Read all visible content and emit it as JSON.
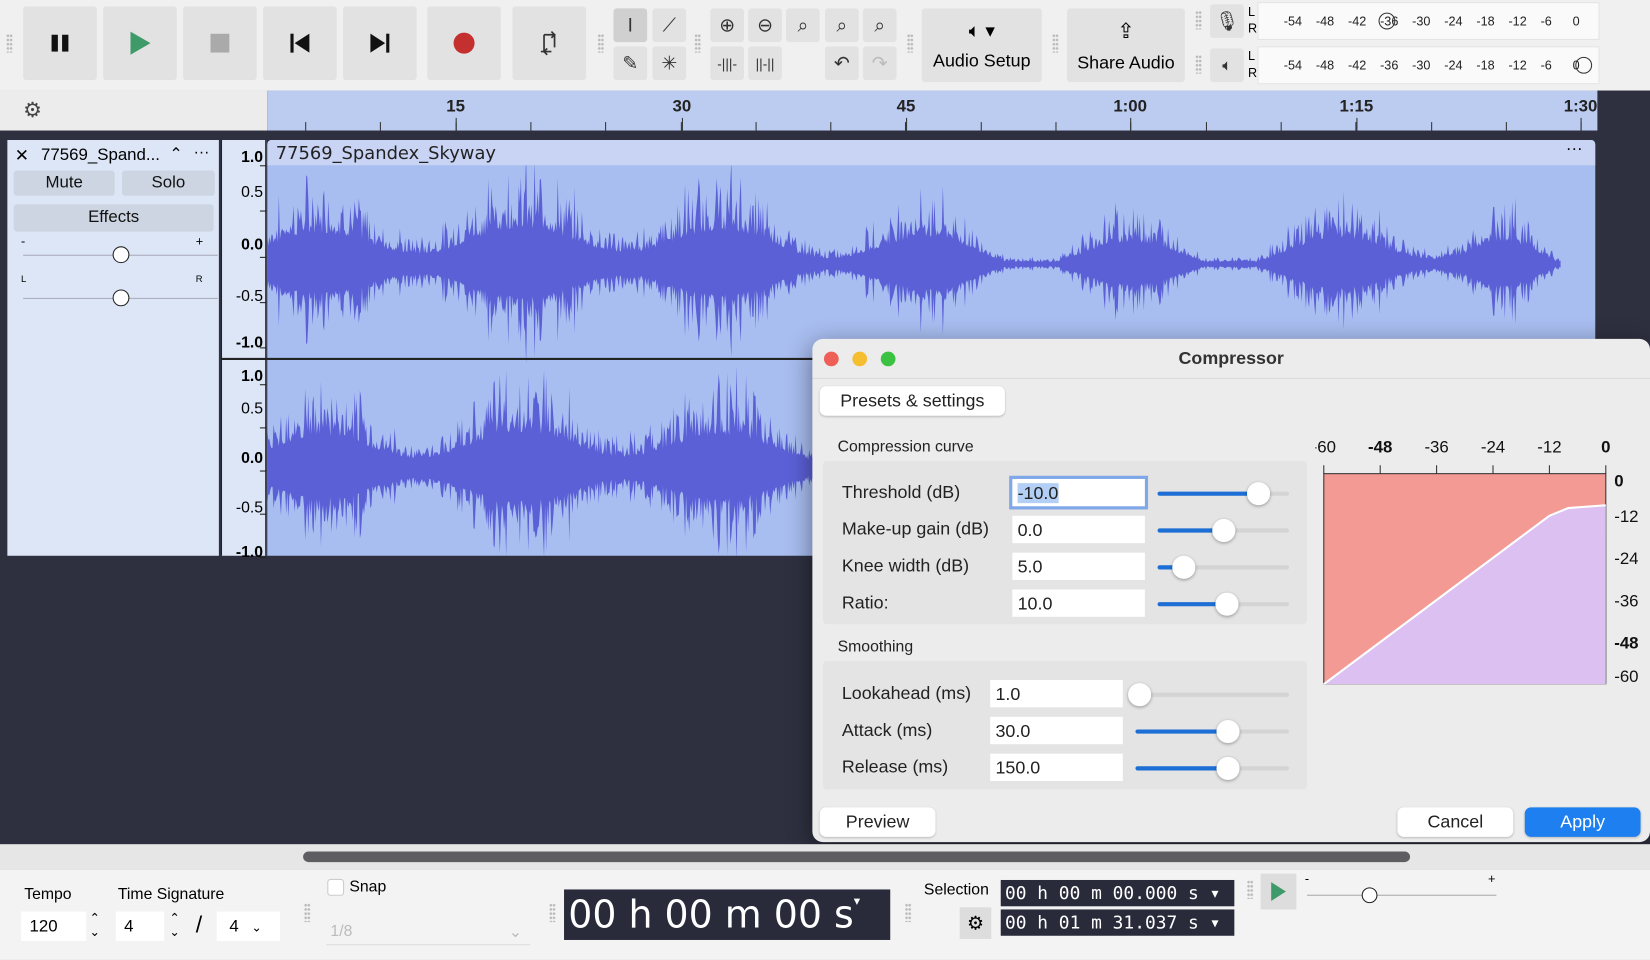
{
  "toolbar": {
    "transport": [
      "pause",
      "play",
      "stop",
      "skip-to-start",
      "skip-to-end",
      "record",
      "loop"
    ],
    "audio_setup": "Audio Setup",
    "share_audio": "Share Audio",
    "record_meter": {
      "channels": [
        "L",
        "R"
      ],
      "ticks": [
        "-54",
        "-48",
        "-42",
        "-36",
        "-30",
        "-24",
        "-18",
        "-12",
        "-6",
        "0"
      ]
    },
    "playback_meter": {
      "channels": [
        "L",
        "R"
      ],
      "ticks": [
        "-54",
        "-48",
        "-42",
        "-36",
        "-30",
        "-24",
        "-18",
        "-12",
        "-6",
        "0"
      ]
    }
  },
  "ruler": {
    "labels": [
      "15",
      "30",
      "45",
      "1:00",
      "1:15",
      "1:30"
    ]
  },
  "track": {
    "name": "77569_Spand...",
    "clip_name": "77569_Spandex_Skyway",
    "mute": "Mute",
    "solo": "Solo",
    "effects": "Effects",
    "gain_min": "-",
    "gain_max": "+",
    "pan_left": "L",
    "pan_right": "R",
    "scale": [
      "1.0",
      "0.5",
      "0.0",
      "-0.5",
      "-1.0"
    ],
    "gain_level": 0.5,
    "pan_level": 0.5,
    "wave_color": "#5b60d6"
  },
  "dialog": {
    "title": "Compressor",
    "presets": "Presets & settings",
    "curve_section": "Compression curve",
    "curve_params": [
      {
        "label": "Threshold (dB)",
        "value": "-10.0",
        "level": 0.77
      },
      {
        "label": "Make-up gain (dB)",
        "value": "0.0",
        "level": 0.5
      },
      {
        "label": "Knee width (dB)",
        "value": "5.0",
        "level": 0.2
      },
      {
        "label": "Ratio:",
        "value": "10.0",
        "level": 0.53
      }
    ],
    "smoothing_section": "Smoothing",
    "smoothing_params": [
      {
        "label": "Lookahead (ms)",
        "value": "1.0",
        "level": 0.03
      },
      {
        "label": "Attack (ms)",
        "value": "30.0",
        "level": 0.6
      },
      {
        "label": "Release (ms)",
        "value": "150.0",
        "level": 0.6
      }
    ],
    "graph_x_ticks": [
      "-60",
      "-48",
      "-36",
      "-24",
      "-12",
      "0"
    ],
    "graph_y_ticks": [
      "0",
      "-12",
      "-24",
      "-36",
      "-48",
      "-60"
    ],
    "preview": "Preview",
    "cancel": "Cancel",
    "apply": "Apply",
    "accent": "#1d7ff0"
  },
  "bottom": {
    "tempo_label": "Tempo",
    "tempo": "120",
    "timesig_label": "Time Signature",
    "timesig_num": "4",
    "timesig_den": "4",
    "snap_label": "Snap",
    "snap_value": "1/8",
    "time": "00 h 00 m 00 s",
    "selection_label": "Selection",
    "sel_start": "00 h 00 m 00.000 s",
    "sel_end": "00 h 01 m 31.037 s",
    "speed_min": "-",
    "speed_max": "+"
  }
}
